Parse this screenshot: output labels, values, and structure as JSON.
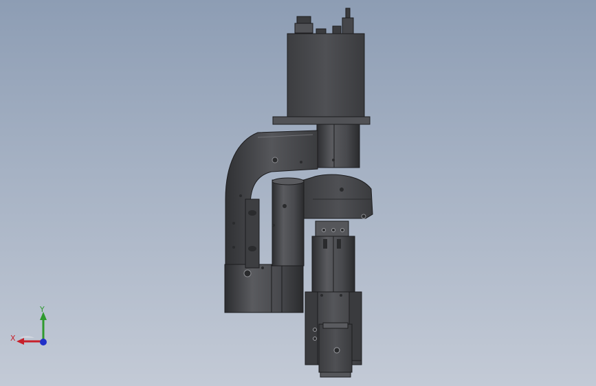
{
  "viewport": {
    "background_top": "#8d9db4",
    "background_bottom": "#c3cad6"
  },
  "model": {
    "body_color": "#4a4b4e",
    "shadow_color": "#2b2c2e",
    "highlight_color": "#6a6b6f",
    "edge_color": "#1c1c1e"
  },
  "triad": {
    "x_label": "X",
    "y_label": "Y",
    "x_color": "#c8202a",
    "y_color": "#2e9a2e",
    "z_color": "#2030c8"
  }
}
